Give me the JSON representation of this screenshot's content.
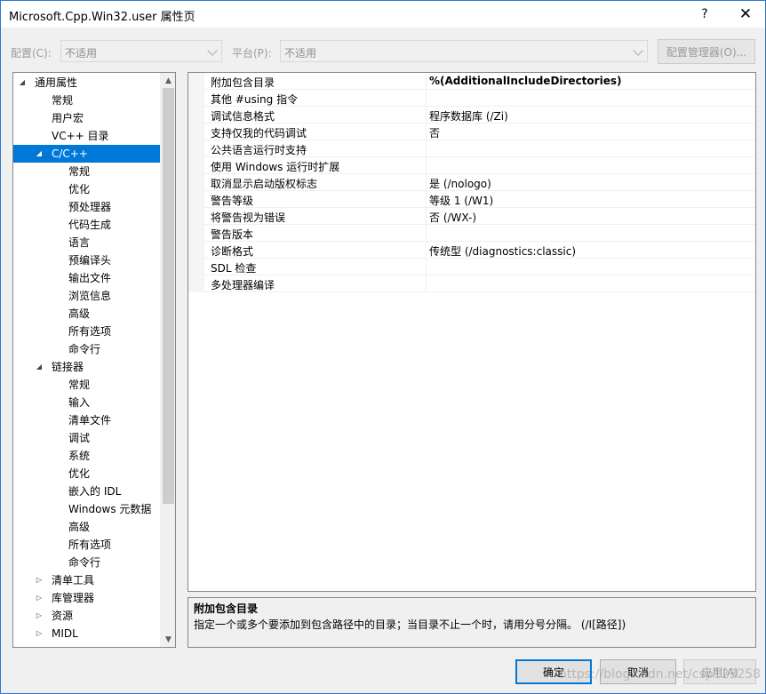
{
  "window": {
    "title": "Microsoft.Cpp.Win32.user 属性页",
    "help_label": "?",
    "close_label": "✕"
  },
  "config": {
    "config_label": "配置(C):",
    "config_value": "不适用",
    "platform_label": "平台(P):",
    "platform_value": "不适用",
    "manager_label": "配置管理器(O)..."
  },
  "tree": {
    "scroll_up": "▲",
    "scroll_down": "▼",
    "items": [
      {
        "label": "通用属性",
        "level": 0,
        "expander": "◢"
      },
      {
        "label": "常规",
        "level": 1,
        "expander": ""
      },
      {
        "label": "用户宏",
        "level": 1,
        "expander": ""
      },
      {
        "label": "VC++ 目录",
        "level": 1,
        "expander": ""
      },
      {
        "label": "C/C++",
        "level": 1,
        "expander": "◢",
        "selected": true
      },
      {
        "label": "常规",
        "level": 2,
        "expander": ""
      },
      {
        "label": "优化",
        "level": 2,
        "expander": ""
      },
      {
        "label": "预处理器",
        "level": 2,
        "expander": ""
      },
      {
        "label": "代码生成",
        "level": 2,
        "expander": ""
      },
      {
        "label": "语言",
        "level": 2,
        "expander": ""
      },
      {
        "label": "预编译头",
        "level": 2,
        "expander": ""
      },
      {
        "label": "输出文件",
        "level": 2,
        "expander": ""
      },
      {
        "label": "浏览信息",
        "level": 2,
        "expander": ""
      },
      {
        "label": "高级",
        "level": 2,
        "expander": ""
      },
      {
        "label": "所有选项",
        "level": 2,
        "expander": ""
      },
      {
        "label": "命令行",
        "level": 2,
        "expander": ""
      },
      {
        "label": "链接器",
        "level": 1,
        "expander": "◢"
      },
      {
        "label": "常规",
        "level": 2,
        "expander": ""
      },
      {
        "label": "输入",
        "level": 2,
        "expander": ""
      },
      {
        "label": "清单文件",
        "level": 2,
        "expander": ""
      },
      {
        "label": "调试",
        "level": 2,
        "expander": ""
      },
      {
        "label": "系统",
        "level": 2,
        "expander": ""
      },
      {
        "label": "优化",
        "level": 2,
        "expander": ""
      },
      {
        "label": "嵌入的 IDL",
        "level": 2,
        "expander": ""
      },
      {
        "label": "Windows 元数据",
        "level": 2,
        "expander": ""
      },
      {
        "label": "高级",
        "level": 2,
        "expander": ""
      },
      {
        "label": "所有选项",
        "level": 2,
        "expander": ""
      },
      {
        "label": "命令行",
        "level": 2,
        "expander": ""
      },
      {
        "label": "清单工具",
        "level": 1,
        "expander": "▷"
      },
      {
        "label": "库管理器",
        "level": 1,
        "expander": "▷"
      },
      {
        "label": "资源",
        "level": 1,
        "expander": "▷"
      },
      {
        "label": "MIDL",
        "level": 1,
        "expander": "▷"
      }
    ]
  },
  "grid": {
    "rows": [
      {
        "name": "附加包含目录",
        "value": "%(AdditionalIncludeDirectories)",
        "bold": true
      },
      {
        "name": "其他 #using 指令",
        "value": ""
      },
      {
        "name": "调试信息格式",
        "value": "程序数据库 (/Zi)"
      },
      {
        "name": "支持仅我的代码调试",
        "value": "否"
      },
      {
        "name": "公共语言运行时支持",
        "value": ""
      },
      {
        "name": "使用 Windows 运行时扩展",
        "value": ""
      },
      {
        "name": "取消显示启动版权标志",
        "value": "是 (/nologo)"
      },
      {
        "name": "警告等级",
        "value": "等级 1 (/W1)"
      },
      {
        "name": "将警告视为错误",
        "value": "否 (/WX-)"
      },
      {
        "name": "警告版本",
        "value": ""
      },
      {
        "name": "诊断格式",
        "value": "传统型 (/diagnostics:classic)"
      },
      {
        "name": "SDL 检查",
        "value": ""
      },
      {
        "name": "多处理器编译",
        "value": ""
      }
    ]
  },
  "description": {
    "title": "附加包含目录",
    "text": "指定一个或多个要添加到包含路径中的目录；当目录不止一个时，请用分号分隔。      (/I[路径])"
  },
  "buttons": {
    "ok": "确定",
    "cancel": "取消",
    "apply": "应用(A)"
  },
  "watermark": "https://blog.csdn.net/csp123258"
}
